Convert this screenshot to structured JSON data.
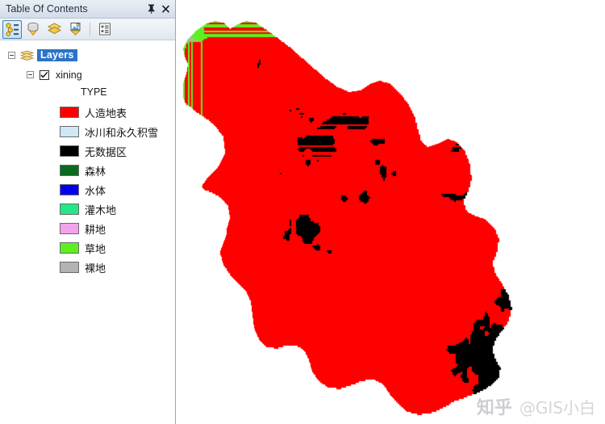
{
  "panel": {
    "title": "Table Of Contents",
    "pin_icon": "pin-icon",
    "close_icon": "close-icon",
    "toolbar": [
      {
        "name": "list-by-drawing-order-button",
        "icon": "drawing-order-icon",
        "active": true
      },
      {
        "name": "list-by-source-button",
        "icon": "source-icon",
        "active": false
      },
      {
        "name": "list-by-visibility-button",
        "icon": "visibility-icon",
        "active": false
      },
      {
        "name": "list-by-selection-button",
        "icon": "selection-icon",
        "active": false
      },
      {
        "name": "options-button",
        "icon": "options-list-icon",
        "active": false
      }
    ]
  },
  "tree": {
    "root": {
      "label": "Layers",
      "expander": "collapse-icon",
      "icon": "layer-stack-icon",
      "selected": true
    },
    "layer": {
      "label": "xining",
      "expander": "collapse-icon",
      "checked": true,
      "checkbox_glyph": "✔"
    },
    "field_label": "TYPE"
  },
  "legend": [
    {
      "label": "人造地表",
      "color": "#ff0000",
      "name": "legend-item-artificial-surface"
    },
    {
      "label": "冰川和永久积雪",
      "color": "#cfe8f3",
      "name": "legend-item-glacier-snow"
    },
    {
      "label": "无数据区",
      "color": "#000000",
      "name": "legend-item-nodata"
    },
    {
      "label": "森林",
      "color": "#0a6b20",
      "name": "legend-item-forest"
    },
    {
      "label": "水体",
      "color": "#0000ee",
      "name": "legend-item-water"
    },
    {
      "label": "灌木地",
      "color": "#22e88a",
      "name": "legend-item-shrubland"
    },
    {
      "label": "耕地",
      "color": "#f3a3ec",
      "name": "legend-item-cropland"
    },
    {
      "label": "草地",
      "color": "#5cf021",
      "name": "legend-item-grassland"
    },
    {
      "label": "裸地",
      "color": "#b3b3b3",
      "name": "legend-item-bareland"
    }
  ],
  "map": {
    "background": "#ffffff",
    "watermark_site": "知乎",
    "watermark_user": "@GIS小白"
  },
  "chart_data": {
    "type": "heatmap",
    "title": "xining land cover TYPE",
    "legend_position": "left-panel",
    "classes": [
      {
        "label": "人造地表",
        "color": "#ff0000"
      },
      {
        "label": "冰川和永久积雪",
        "color": "#cfe8f3"
      },
      {
        "label": "无数据区",
        "color": "#000000"
      },
      {
        "label": "森林",
        "color": "#0a6b20"
      },
      {
        "label": "水体",
        "color": "#0000ee"
      },
      {
        "label": "灌木地",
        "color": "#22e88a"
      },
      {
        "label": "耕地",
        "color": "#f3a3ec"
      },
      {
        "label": "草地",
        "color": "#5cf021"
      },
      {
        "label": "裸地",
        "color": "#b3b3b3"
      }
    ]
  }
}
